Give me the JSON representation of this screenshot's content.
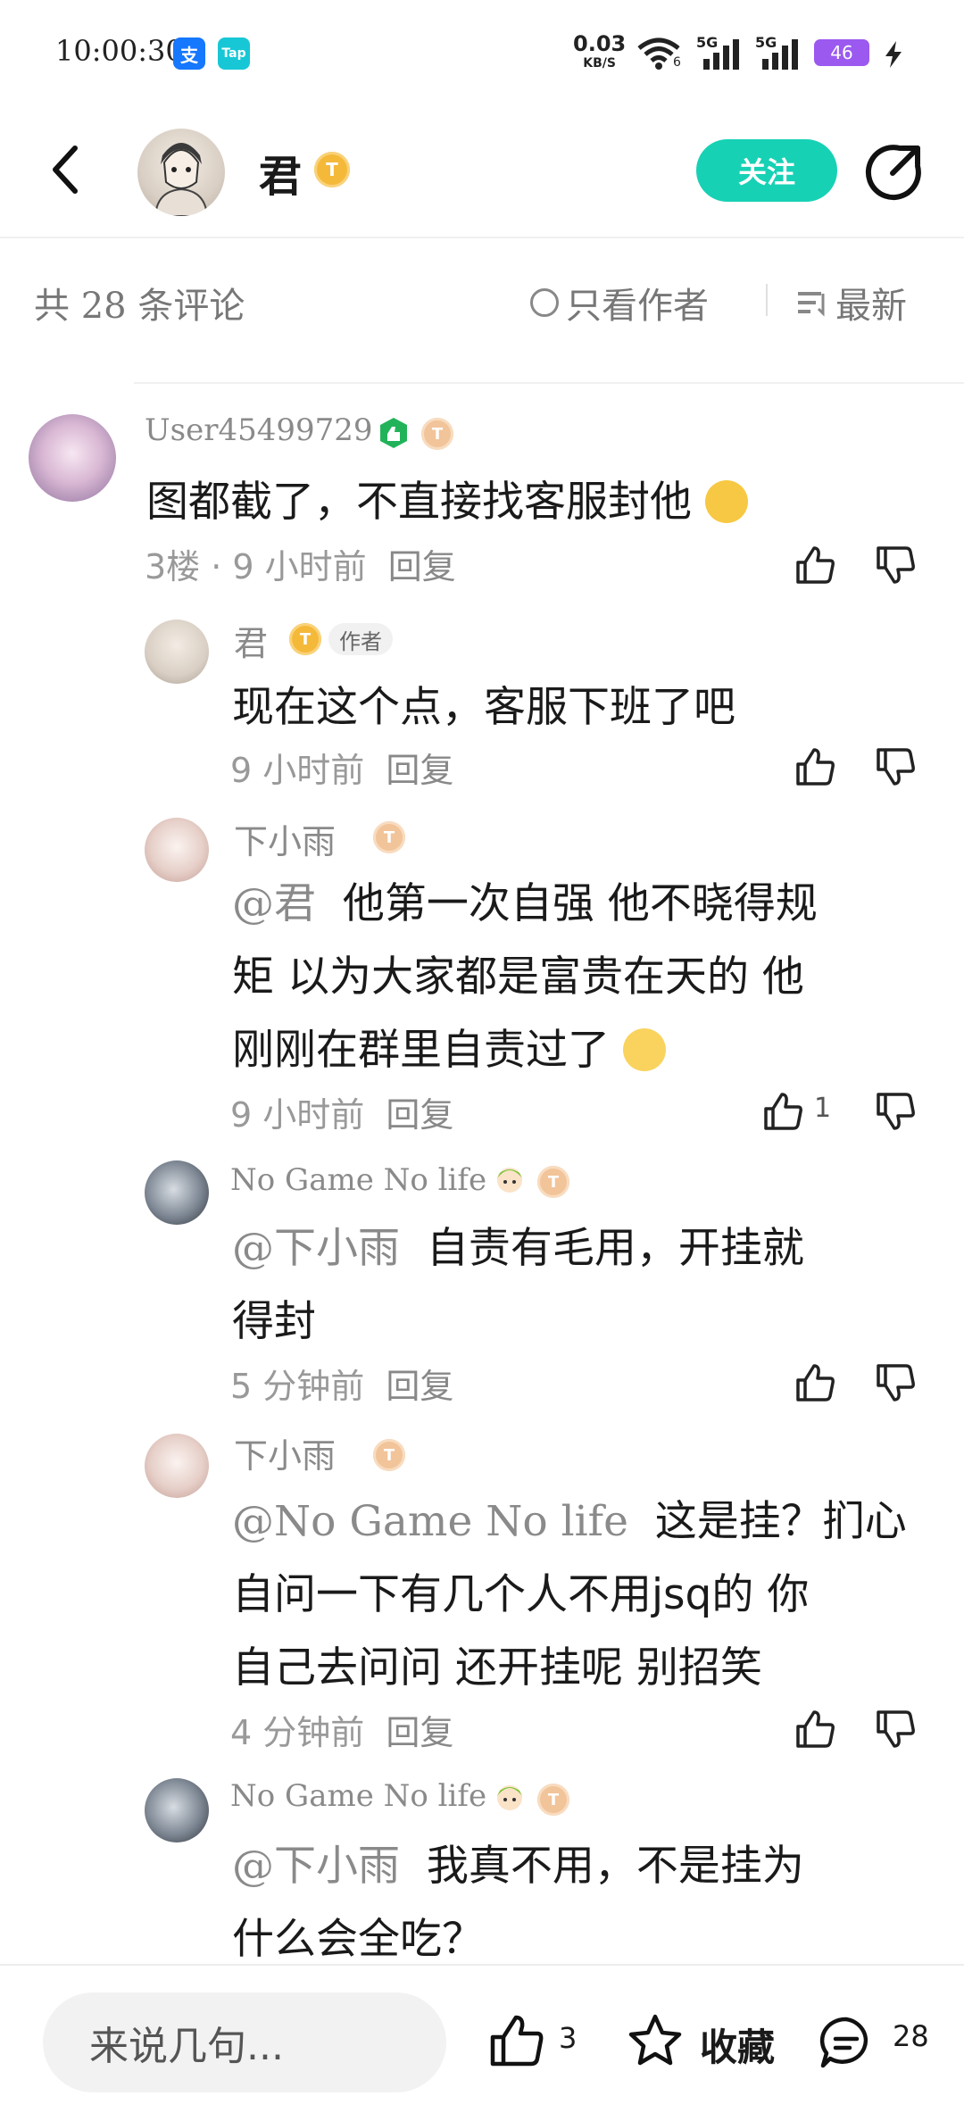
{
  "status_bar": {
    "time": "10:00:30",
    "app_icons": [
      {
        "name": "alipay-icon",
        "label": "支",
        "color": "#1677ff"
      },
      {
        "name": "taptap-icon",
        "label": "Tap",
        "color": "#17c7d6"
      }
    ],
    "net_speed": "0.03",
    "net_unit": "KB/S",
    "wifi_sub": "6",
    "signal_1": "5G",
    "signal_2": "5G",
    "battery": "46"
  },
  "header": {
    "name": "君",
    "level": "T",
    "follow_label": "关注"
  },
  "comments_bar": {
    "count_prefix": "共",
    "count": "28",
    "count_suffix": "条评论",
    "only_author": "只看作者",
    "sort": "最新"
  },
  "comments": [
    {
      "user": "User45499729",
      "level": "T",
      "text": "图都截了，不直接找客服封他",
      "floor": "3楼 · 9 小时前",
      "reply": "回复"
    },
    {
      "user": "君",
      "level": "T",
      "tag": "作者",
      "text": "现在这个点，客服下班了吧",
      "time": "9 小时前",
      "reply": "回复"
    },
    {
      "user": "下小雨",
      "level": "T",
      "mention": "@君",
      "text_lines": [
        "他第一次自强 他不晓得规",
        "矩 以为大家都是富贵在天的 他",
        "刚刚在群里自责过了"
      ],
      "time": "9 小时前",
      "reply": "回复",
      "likes": "1"
    },
    {
      "user": "No Game No life",
      "level": "T",
      "mention": "@下小雨",
      "text_lines": [
        "自责有毛用，开挂就",
        "得封"
      ],
      "time": "5 分钟前",
      "reply": "回复"
    },
    {
      "user": "下小雨",
      "level": "T",
      "mention": "@No Game No life",
      "text_lines": [
        "这是挂？扪心",
        "自问一下有几个人不用jsq的 你",
        "自己去问问 还开挂呢 别招笑"
      ],
      "time": "4 分钟前",
      "reply": "回复"
    },
    {
      "user": "No Game No life",
      "level": "T",
      "mention": "@下小雨",
      "text_lines": [
        "我真不用，不是挂为",
        "什么会全吃？"
      ]
    }
  ],
  "bottom_bar": {
    "input_placeholder": "来说几句...",
    "like_count": "3",
    "collect_label": "收藏",
    "comment_count": "28"
  }
}
